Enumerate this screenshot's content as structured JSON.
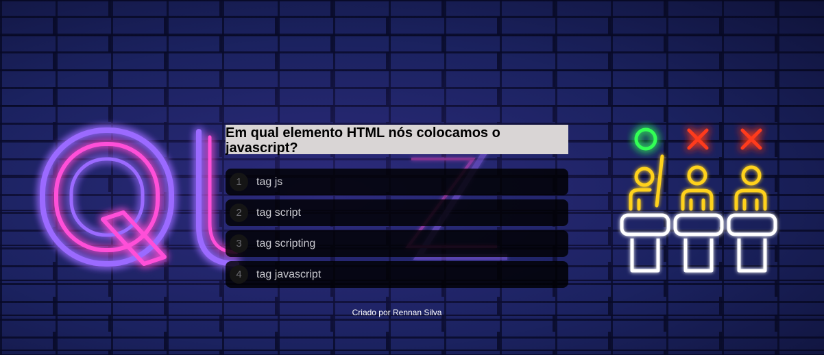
{
  "quiz": {
    "question": "Em qual elemento HTML nós colocamos o javascript?",
    "answers": [
      {
        "number": "1",
        "label": "tag js"
      },
      {
        "number": "2",
        "label": "tag script"
      },
      {
        "number": "3",
        "label": "tag scripting"
      },
      {
        "number": "4",
        "label": "tag javascript"
      }
    ]
  },
  "footer": {
    "credit": "Criado por Rennan Silva"
  },
  "decor": {
    "background_color": "#1b2260",
    "neon_pink": "#ff4fd8",
    "neon_purple": "#9b6bff",
    "neon_green": "#33ff55",
    "neon_red": "#ff3a1a",
    "neon_yellow": "#ffd21f",
    "neon_white": "#ffffff"
  }
}
